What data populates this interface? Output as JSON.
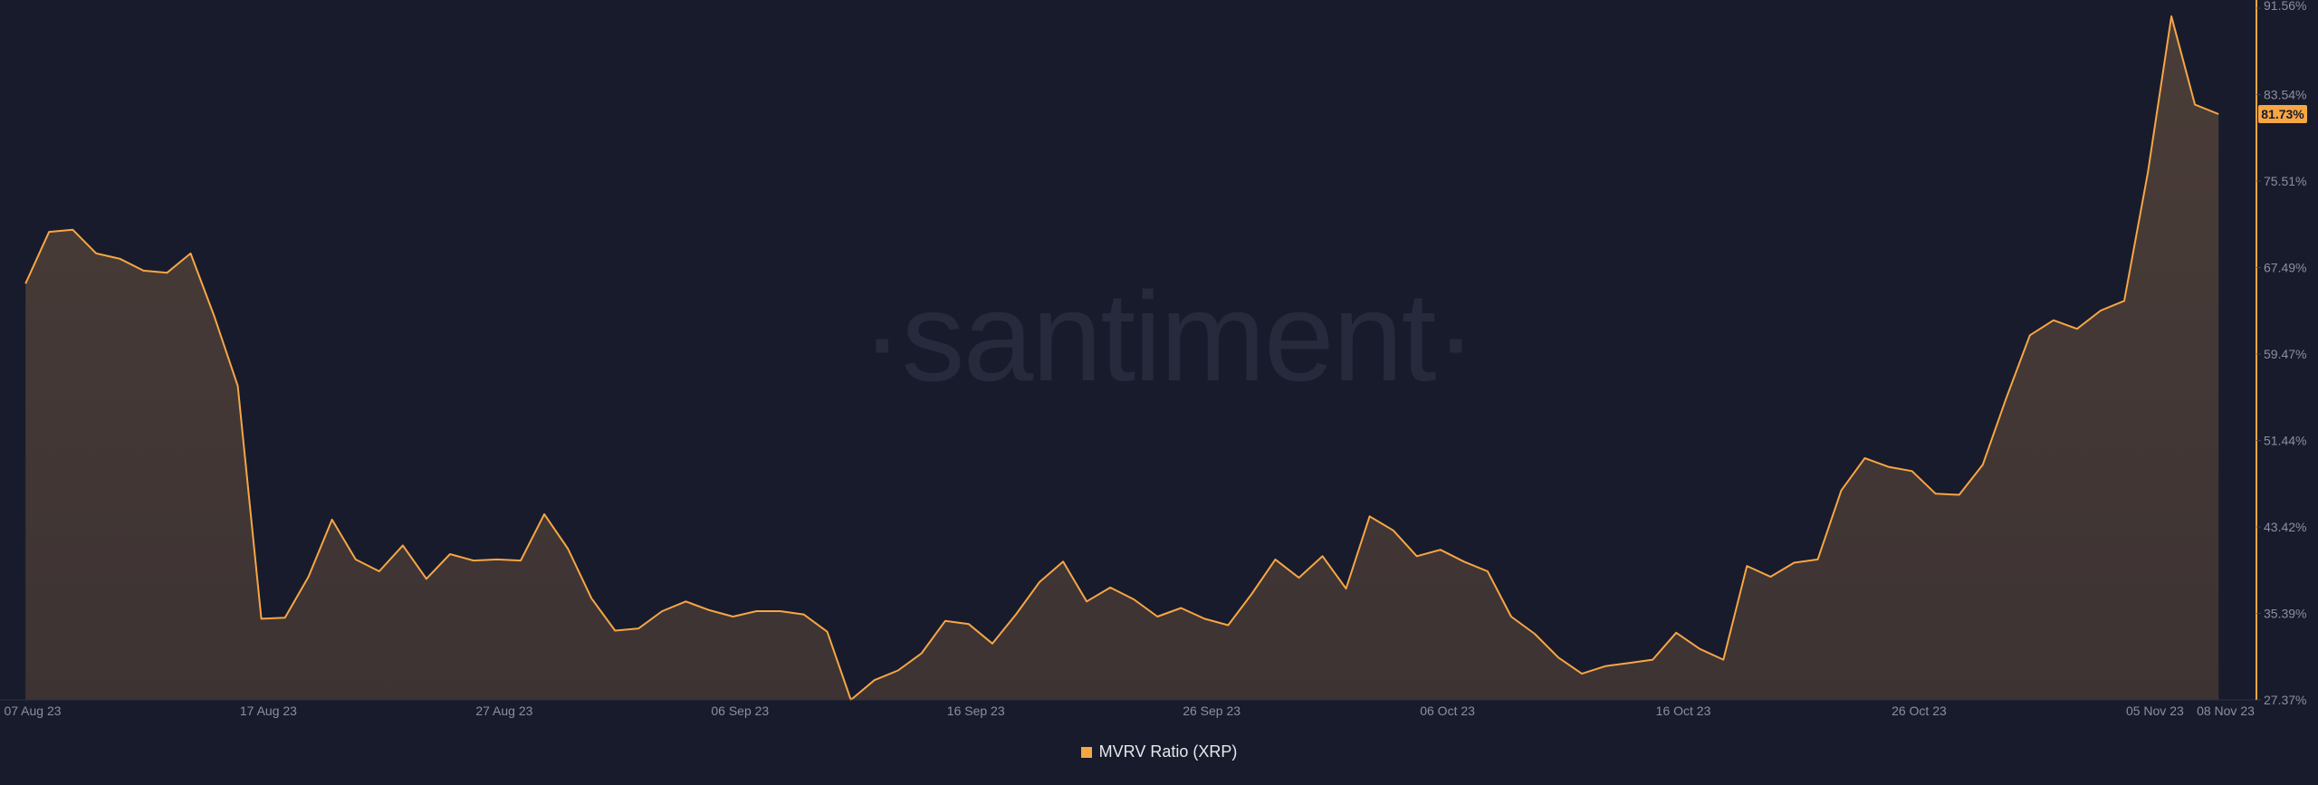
{
  "chart_data": {
    "type": "area",
    "watermark": "·santiment·",
    "x_ticks": [
      "07 Aug 23",
      "17 Aug 23",
      "27 Aug 23",
      "06 Sep 23",
      "16 Sep 23",
      "26 Sep 23",
      "06 Oct 23",
      "16 Oct 23",
      "26 Oct 23",
      "05 Nov 23",
      "08 Nov 23"
    ],
    "y_ticks": [
      "91.56%",
      "83.54%",
      "75.51%",
      "67.49%",
      "59.47%",
      "51.44%",
      "43.42%",
      "35.39%",
      "27.37%"
    ],
    "ylim": [
      27.37,
      91.56
    ],
    "xlim_days": [
      0,
      93
    ],
    "grid": false,
    "legend_position": "bottom-center",
    "current_value_label": "81.73%",
    "series": [
      {
        "name": "MVRV Ratio (XRP)",
        "color": "#f7a644",
        "points": [
          [
            -0.3,
            66.0
          ],
          [
            0.7,
            70.8
          ],
          [
            1.7,
            71.0
          ],
          [
            2.7,
            68.8
          ],
          [
            3.7,
            68.3
          ],
          [
            4.7,
            67.2
          ],
          [
            5.7,
            67.0
          ],
          [
            6.7,
            68.8
          ],
          [
            7.7,
            63.0
          ],
          [
            8.7,
            56.5
          ],
          [
            9.7,
            34.9
          ],
          [
            10.7,
            35.0
          ],
          [
            11.7,
            38.8
          ],
          [
            12.7,
            44.1
          ],
          [
            13.7,
            40.4
          ],
          [
            14.7,
            39.3
          ],
          [
            15.7,
            41.7
          ],
          [
            16.7,
            38.6
          ],
          [
            17.7,
            40.9
          ],
          [
            18.7,
            40.3
          ],
          [
            19.7,
            40.4
          ],
          [
            20.7,
            40.3
          ],
          [
            21.7,
            44.6
          ],
          [
            22.7,
            41.4
          ],
          [
            23.7,
            36.8
          ],
          [
            24.7,
            33.8
          ],
          [
            25.7,
            34.0
          ],
          [
            26.7,
            35.6
          ],
          [
            27.7,
            36.5
          ],
          [
            28.7,
            35.7
          ],
          [
            29.7,
            35.1
          ],
          [
            30.7,
            35.6
          ],
          [
            31.7,
            35.6
          ],
          [
            32.7,
            35.3
          ],
          [
            33.7,
            33.7
          ],
          [
            34.7,
            27.37
          ],
          [
            35.7,
            29.2
          ],
          [
            36.7,
            30.1
          ],
          [
            37.7,
            31.7
          ],
          [
            38.7,
            34.7
          ],
          [
            39.7,
            34.4
          ],
          [
            40.7,
            32.6
          ],
          [
            41.7,
            35.3
          ],
          [
            42.7,
            38.3
          ],
          [
            43.7,
            40.2
          ],
          [
            44.7,
            36.5
          ],
          [
            45.7,
            37.8
          ],
          [
            46.7,
            36.7
          ],
          [
            47.7,
            35.1
          ],
          [
            48.7,
            35.9
          ],
          [
            49.7,
            34.9
          ],
          [
            50.7,
            34.3
          ],
          [
            51.7,
            37.2
          ],
          [
            52.7,
            40.4
          ],
          [
            53.7,
            38.7
          ],
          [
            54.7,
            40.7
          ],
          [
            55.7,
            37.7
          ],
          [
            56.7,
            44.4
          ],
          [
            57.7,
            43.1
          ],
          [
            58.7,
            40.7
          ],
          [
            59.7,
            41.3
          ],
          [
            60.7,
            40.2
          ],
          [
            61.7,
            39.3
          ],
          [
            62.7,
            35.1
          ],
          [
            63.7,
            33.5
          ],
          [
            64.7,
            31.3
          ],
          [
            65.7,
            29.8
          ],
          [
            66.7,
            30.5
          ],
          [
            67.7,
            30.8
          ],
          [
            68.7,
            31.1
          ],
          [
            69.7,
            33.6
          ],
          [
            70.7,
            32.1
          ],
          [
            71.7,
            31.1
          ],
          [
            72.7,
            39.8
          ],
          [
            73.7,
            38.8
          ],
          [
            74.7,
            40.1
          ],
          [
            75.7,
            40.4
          ],
          [
            76.7,
            46.8
          ],
          [
            77.7,
            49.8
          ],
          [
            78.7,
            49.0
          ],
          [
            79.7,
            48.6
          ],
          [
            80.7,
            46.5
          ],
          [
            81.7,
            46.4
          ],
          [
            82.7,
            49.2
          ],
          [
            83.7,
            55.4
          ],
          [
            84.7,
            61.2
          ],
          [
            85.7,
            62.6
          ],
          [
            86.7,
            61.8
          ],
          [
            87.7,
            63.5
          ],
          [
            88.7,
            64.4
          ],
          [
            89.7,
            76.3
          ],
          [
            90.7,
            90.8
          ],
          [
            91.7,
            82.6
          ],
          [
            92.7,
            81.73
          ]
        ]
      }
    ]
  }
}
